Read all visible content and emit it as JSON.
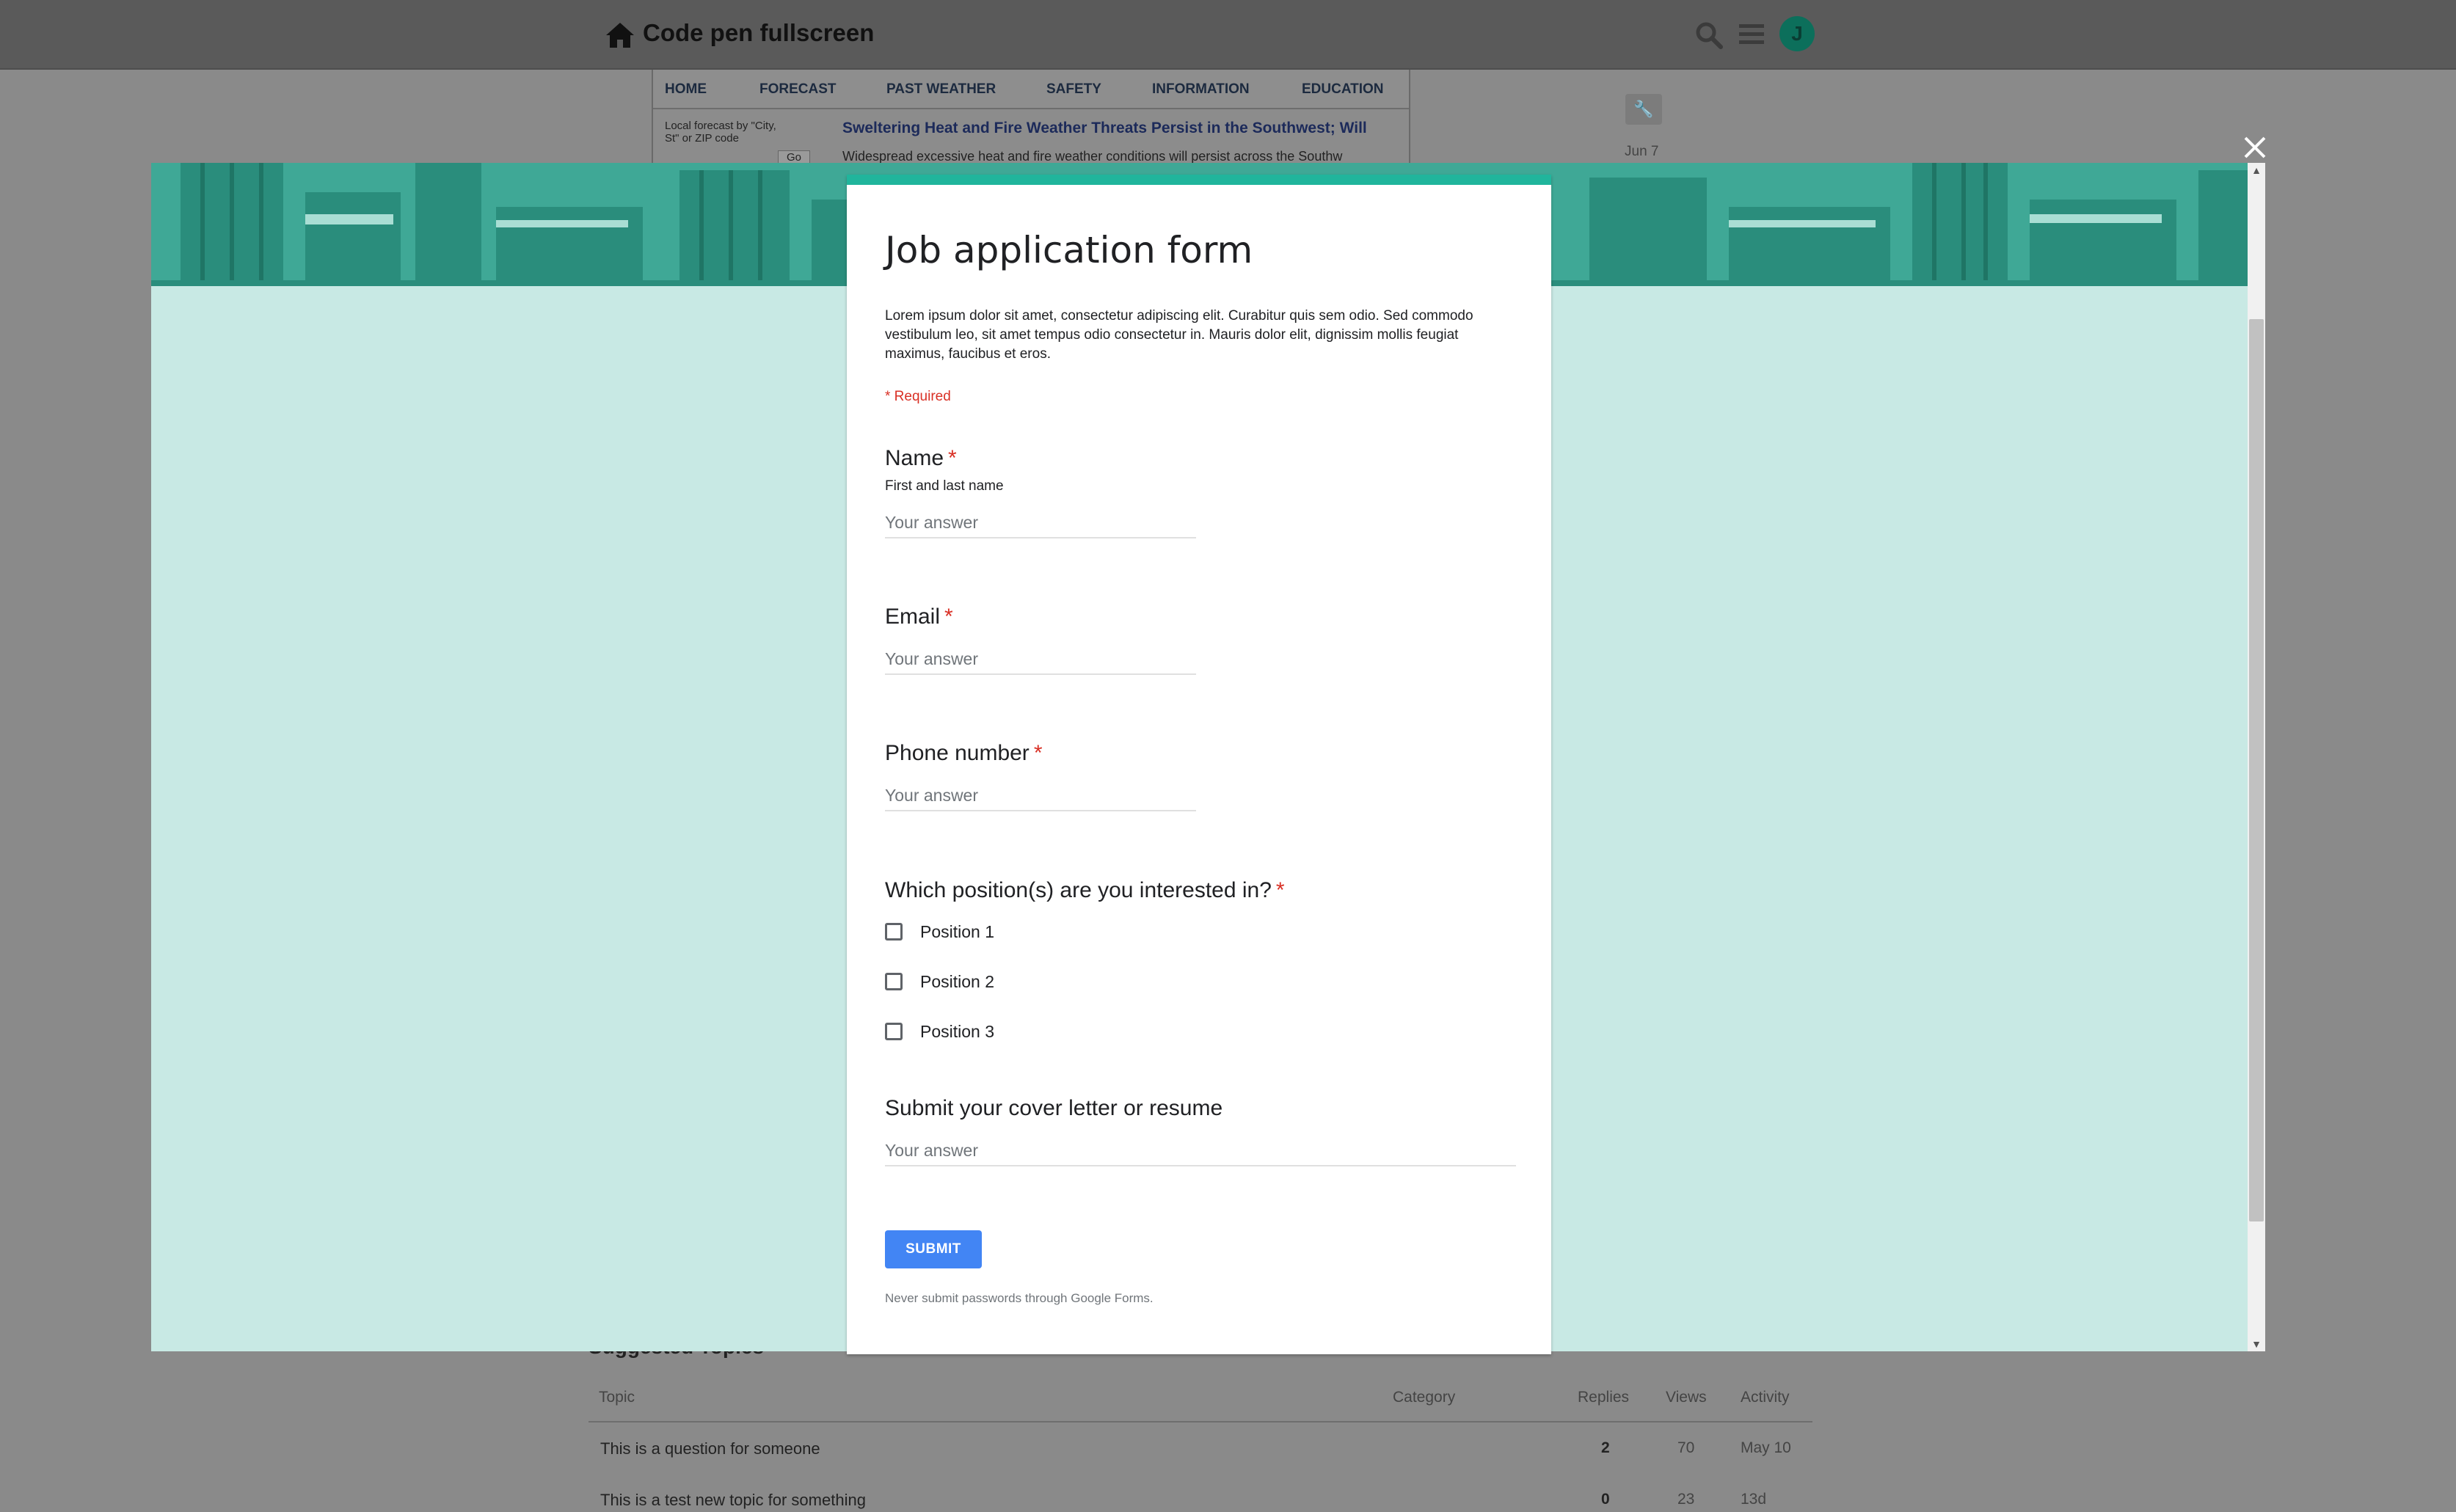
{
  "site": {
    "title": "Code pen fullscreen",
    "avatar_letter": "J"
  },
  "embed": {
    "nav": [
      "HOME",
      "FORECAST",
      "PAST WEATHER",
      "SAFETY",
      "INFORMATION",
      "EDUCATION"
    ],
    "left_text": "Local forecast by \"City, St\" or ZIP code",
    "go_label": "Go",
    "headline": "Sweltering Heat and Fire Weather Threats Persist in the Southwest; Will",
    "subline": "Widespread excessive heat and fire weather conditions will persist across the Southw"
  },
  "side": {
    "date": "Jun 7"
  },
  "suggested": {
    "title": "Suggested Topics",
    "headers": {
      "topic": "Topic",
      "category": "Category",
      "replies": "Replies",
      "views": "Views",
      "activity": "Activity"
    },
    "rows": [
      {
        "title": "This is a question for someone",
        "replies": "2",
        "views": "70",
        "activity": "May 10"
      },
      {
        "title": "This is a test new topic for something",
        "replies": "0",
        "views": "23",
        "activity": "13d"
      }
    ]
  },
  "form": {
    "title": "Job application form",
    "description": "Lorem ipsum dolor sit amet, consectetur adipiscing elit. Curabitur quis sem odio. Sed commodo vestibulum leo, sit amet tempus odio consectetur in. Mauris dolor elit, dignissim mollis feugiat maximus, faucibus et eros.",
    "required_note": "* Required",
    "placeholder": "Your answer",
    "questions": {
      "name": {
        "label": "Name",
        "help": "First and last name",
        "star": "*"
      },
      "email": {
        "label": "Email",
        "star": "*"
      },
      "phone": {
        "label": "Phone number",
        "star": "*"
      },
      "position": {
        "label": "Which position(s) are you interested in?",
        "star": "*",
        "options": [
          "Position 1",
          "Position 2",
          "Position 3"
        ]
      },
      "cover": {
        "label": "Submit your cover letter or resume"
      }
    },
    "submit_label": "SUBMIT",
    "footer_note": "Never submit passwords through Google Forms."
  },
  "colors": {
    "accent": "#20b59c",
    "modal_bg": "#c8e9e4",
    "submit": "#4285f4",
    "required": "#d93025"
  }
}
